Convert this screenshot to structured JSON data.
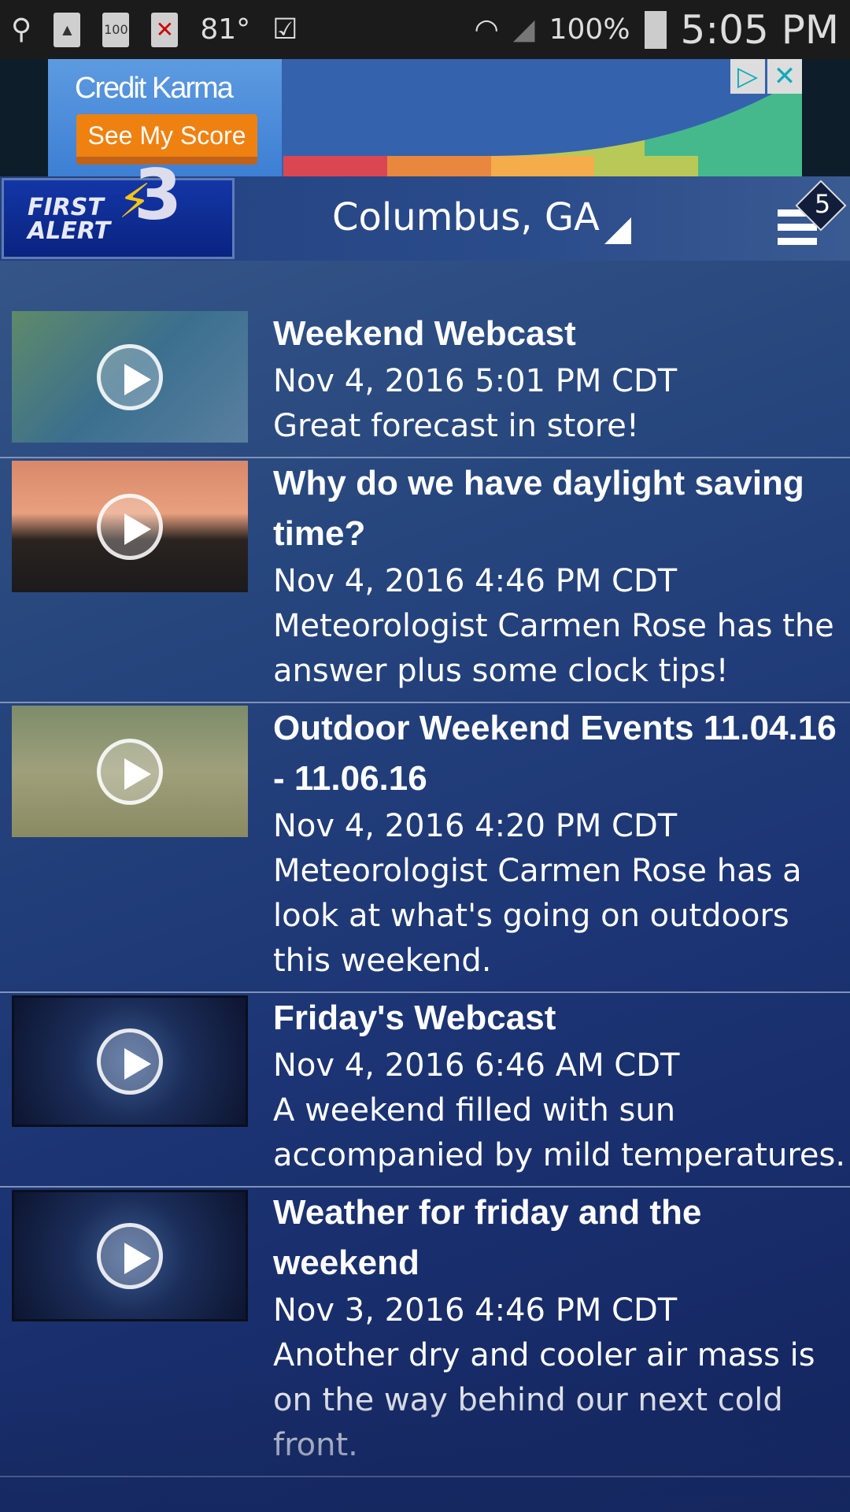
{
  "status_bar": {
    "temperature": "81°",
    "battery": "100%",
    "time": "5:05 PM",
    "icons": [
      "usb-icon",
      "image-icon",
      "battery-100-icon",
      "sd-card-error-icon",
      "clipboard-check-icon",
      "wifi-icon",
      "signal-icon",
      "battery-icon"
    ],
    "battery_badge": "100"
  },
  "ad": {
    "brand": "Credit Karma",
    "cta": "See My Score",
    "bar_colors": [
      "#db4653",
      "#e9873f",
      "#f5ac4a",
      "#b8c957",
      "#45b98c"
    ]
  },
  "header": {
    "logo": "FIRST ALERT 3",
    "location": "Columbus, GA",
    "notification_count": "5"
  },
  "items": [
    {
      "title": "Weekend Webcast",
      "date": "Nov 4, 2016 5:01 PM CDT",
      "description": "Great forecast in store!",
      "thumb": "map"
    },
    {
      "title": "Why do we have daylight saving time?",
      "date": "Nov 4, 2016 4:46 PM CDT",
      "description": "Meteorologist Carmen Rose has the answer plus some clock tips!",
      "thumb": "sunset"
    },
    {
      "title": "Outdoor Weekend Events 11.04.16 - 11.06.16",
      "date": "Nov 4, 2016 4:20 PM CDT",
      "description": "Meteorologist Carmen Rose has a look at what's going on outdoors this weekend.",
      "thumb": "outdoor"
    },
    {
      "title": "Friday's Webcast",
      "date": "Nov 4, 2016 6:46 AM CDT",
      "description": "A weekend filled with sun accompanied by mild temperatures.",
      "thumb": "placeholder"
    },
    {
      "title": "Weather for friday and the weekend",
      "date": "Nov 3, 2016 4:46 PM CDT",
      "description": "Another dry and cooler air mass is on the way behind our next cold front.",
      "thumb": "placeholder"
    }
  ]
}
